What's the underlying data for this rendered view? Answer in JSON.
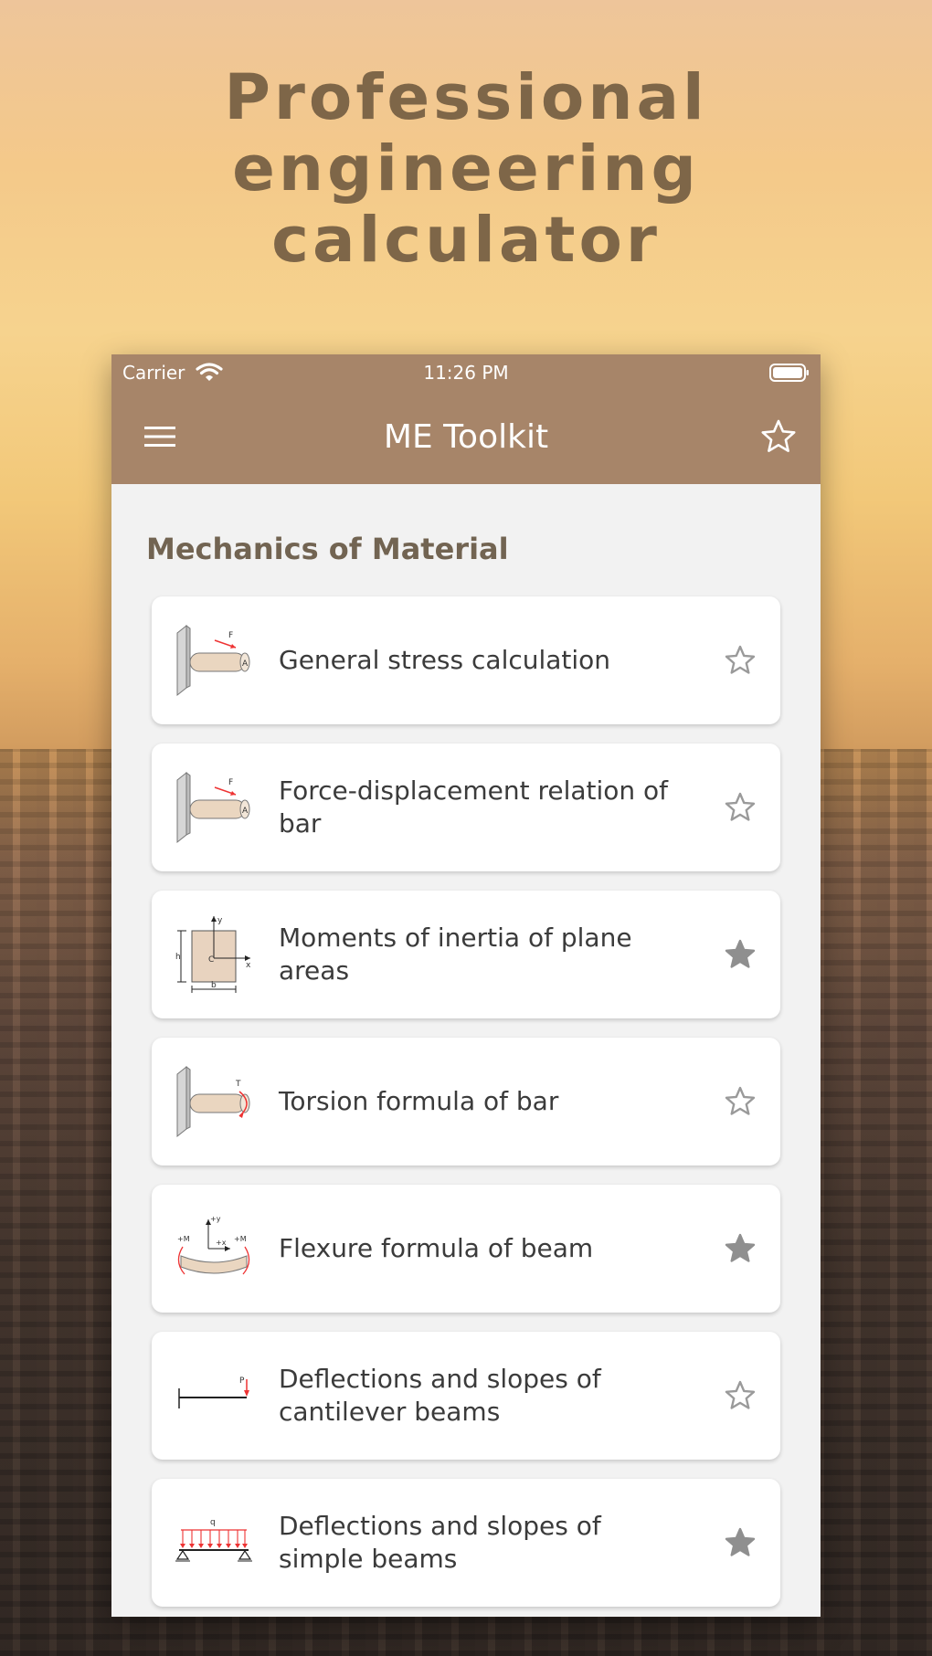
{
  "headline": [
    "Professional",
    "engineering",
    "calculator"
  ],
  "statusbar": {
    "carrier": "Carrier",
    "time": "11:26 PM"
  },
  "navbar": {
    "title": "ME Toolkit",
    "menu_icon": "hamburger-menu-icon",
    "favorite_icon": "star-outline-icon"
  },
  "section": {
    "title": "Mechanics of Material"
  },
  "items": [
    {
      "label": "General stress calculation",
      "icon": "cantilever-bar-force-icon",
      "favorite": false
    },
    {
      "label": "Force-displacement relation of bar",
      "icon": "cantilever-bar-force-icon",
      "favorite": false
    },
    {
      "label": "Moments of inertia of plane areas",
      "icon": "rectangle-cross-section-icon",
      "favorite": true
    },
    {
      "label": "Torsion formula of bar",
      "icon": "cantilever-bar-torque-icon",
      "favorite": false
    },
    {
      "label": "Flexure formula of beam",
      "icon": "beam-bending-icon",
      "favorite": true
    },
    {
      "label": "Deflections and slopes of cantilever beams",
      "icon": "cantilever-beam-load-icon",
      "favorite": false
    },
    {
      "label": "Deflections and slopes of simple beams",
      "icon": "simple-beam-distributed-load-icon",
      "favorite": true
    }
  ],
  "thumb_text": {
    "force": "F",
    "area": "A",
    "torque": "T",
    "x": "x",
    "y": "y",
    "centroid": "C",
    "height": "h",
    "base": "b",
    "plus_y": "+y",
    "plus_x": "+x",
    "plus_m": "+M",
    "point_load": "P",
    "dist_load": "q"
  },
  "colors": {
    "brand": "#a78569",
    "headline": "#7e6648",
    "section_title": "#726452",
    "star_filled": "#8f8f8f",
    "star_outline": "#9a9a9a"
  }
}
